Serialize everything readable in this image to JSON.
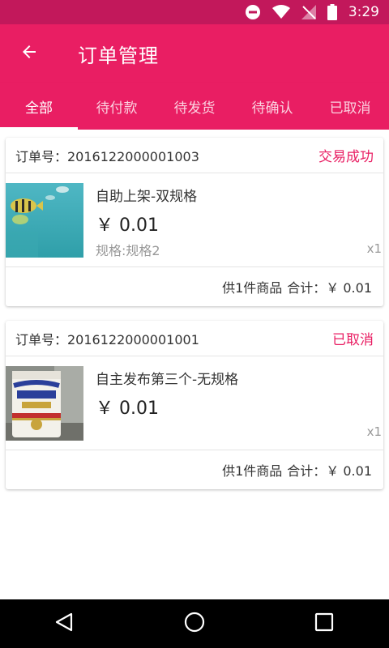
{
  "status_bar": {
    "time": "3:29",
    "icons": [
      "do-not-disturb-icon",
      "wifi-icon",
      "no-signal-icon",
      "battery-icon"
    ]
  },
  "app_bar": {
    "back_icon": "arrow-left-icon",
    "title": "订单管理"
  },
  "tabs": [
    {
      "label": "全部",
      "active": true
    },
    {
      "label": "待付款",
      "active": false
    },
    {
      "label": "待发货",
      "active": false
    },
    {
      "label": "待确认",
      "active": false
    },
    {
      "label": "已取消",
      "active": false
    }
  ],
  "orders": [
    {
      "order_no": "订单号：2016122000001003",
      "status": "交易成功",
      "product_name": "自助上架-双规格",
      "price": "￥ 0.01",
      "spec": "规格:规格2",
      "qty": "x1",
      "summary_count": "供1件商品",
      "summary_total": "合计：￥ 0.01"
    },
    {
      "order_no": "订单号：2016122000001001",
      "status": "已取消",
      "product_name": "自主发布第三个-无规格",
      "price": "￥ 0.01",
      "spec": "",
      "qty": "x1",
      "summary_count": "供1件商品",
      "summary_total": "合计：￥ 0.01"
    }
  ],
  "colors": {
    "primary": "#e91e63",
    "status_bar": "#c2185b",
    "accent_text": "#e91e63"
  },
  "nav_bar": {
    "icons": [
      "back-triangle-icon",
      "home-circle-icon",
      "recents-square-icon"
    ]
  }
}
